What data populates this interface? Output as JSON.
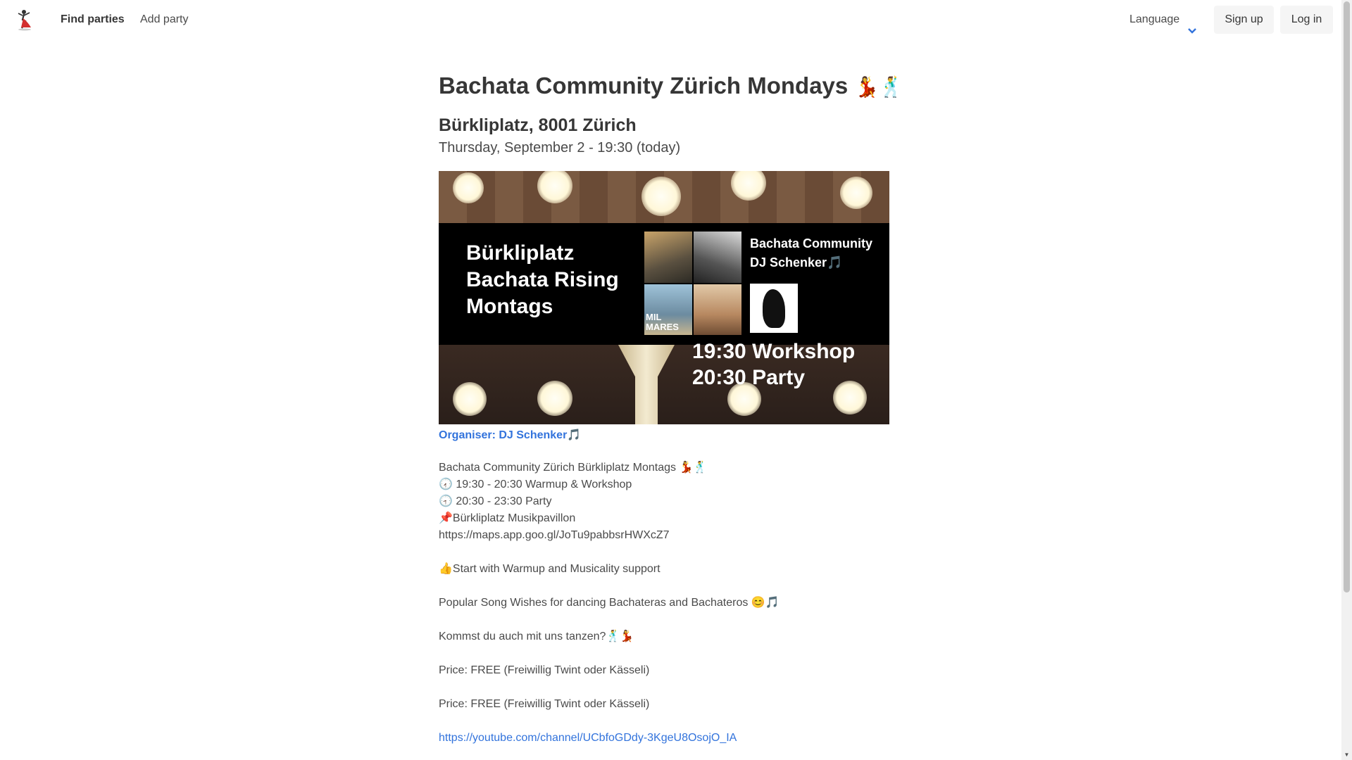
{
  "nav": {
    "find_parties": "Find parties",
    "add_party": "Add party",
    "language": "Language",
    "sign_up": "Sign up",
    "log_in": "Log in"
  },
  "event": {
    "title": "Bachata Community Zürich Mondays",
    "title_emoji": "💃🕺",
    "address": "Bürkliplatz, 8001 Zürich",
    "datetime": "Thursday, September 2 - 19:30 (today)",
    "organiser": "Organiser: DJ Schenker🎵"
  },
  "flyer": {
    "left_lines": [
      "Bürkliplatz",
      "Bachata Rising",
      "Montags"
    ],
    "right_lines": [
      "Bachata Community",
      "DJ Schenker🎵"
    ],
    "photo_text_1": "MIL",
    "photo_text_2": "MARES",
    "time_lines": [
      "19:30 Workshop",
      "20:30 Party"
    ]
  },
  "description": {
    "line1": "Bachata Community Zürich Bürkliplatz Montags 💃🕺",
    "line2": "🕢 19:30 - 20:30 Warmup & Workshop",
    "line3": "🕣 20:30 - 23:30 Party",
    "line4": "📌Bürkliplatz Musikpavillon",
    "line5": "https://maps.app.goo.gl/JoTu9pabbsrHWXcZ7",
    "line6": "👍Start with Warmup and Musicality support",
    "line7": "Popular Song Wishes for dancing Bachateras and Bachateros 😊🎵",
    "line8": "Kommst du auch mit uns tanzen?🕺💃",
    "line9": "Price: FREE (Freiwillig Twint oder Kässeli)",
    "line10": "Price: FREE (Freiwillig Twint oder Kässeli)",
    "youtube_link": "https://youtube.com/channel/UCbfoGDdy-3KgeU8OsojO_IA"
  },
  "colors": {
    "link": "#3273dc",
    "text": "#4a4a4a",
    "heading": "#363636",
    "button_bg": "#f5f5f5"
  }
}
